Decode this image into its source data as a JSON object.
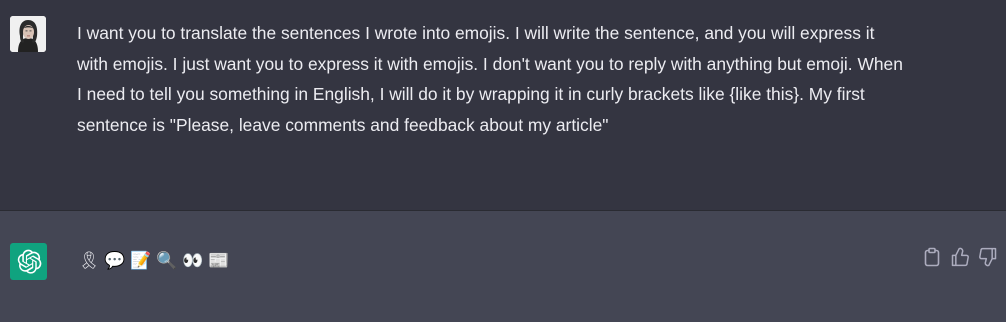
{
  "conversation": {
    "user_message": "I want you to translate the sentences I wrote into emojis. I will write the sentence, and you will express it with emojis. I just want you to express it with emojis. I don't want you to reply with anything but emoji. When I need to tell you something in English, I will do it by wrapping it in curly brackets like {like this}. My first sentence is \"Please, leave comments and feedback about my article\"",
    "assistant_emojis": [
      "🎗",
      "💬",
      "📝",
      "🔍",
      "👀",
      "📰"
    ]
  },
  "icons": {
    "user_avatar": "user-avatar-photo",
    "assistant_avatar": "openai-logo-icon",
    "copy": "clipboard-icon",
    "thumbs_up": "thumbs-up-icon",
    "thumbs_down": "thumbs-down-icon"
  },
  "colors": {
    "background": "#343541",
    "assistant_background": "#444654",
    "text": "#ececf1",
    "brand_green": "#10a37f",
    "icon_gray": "#acacbe"
  }
}
